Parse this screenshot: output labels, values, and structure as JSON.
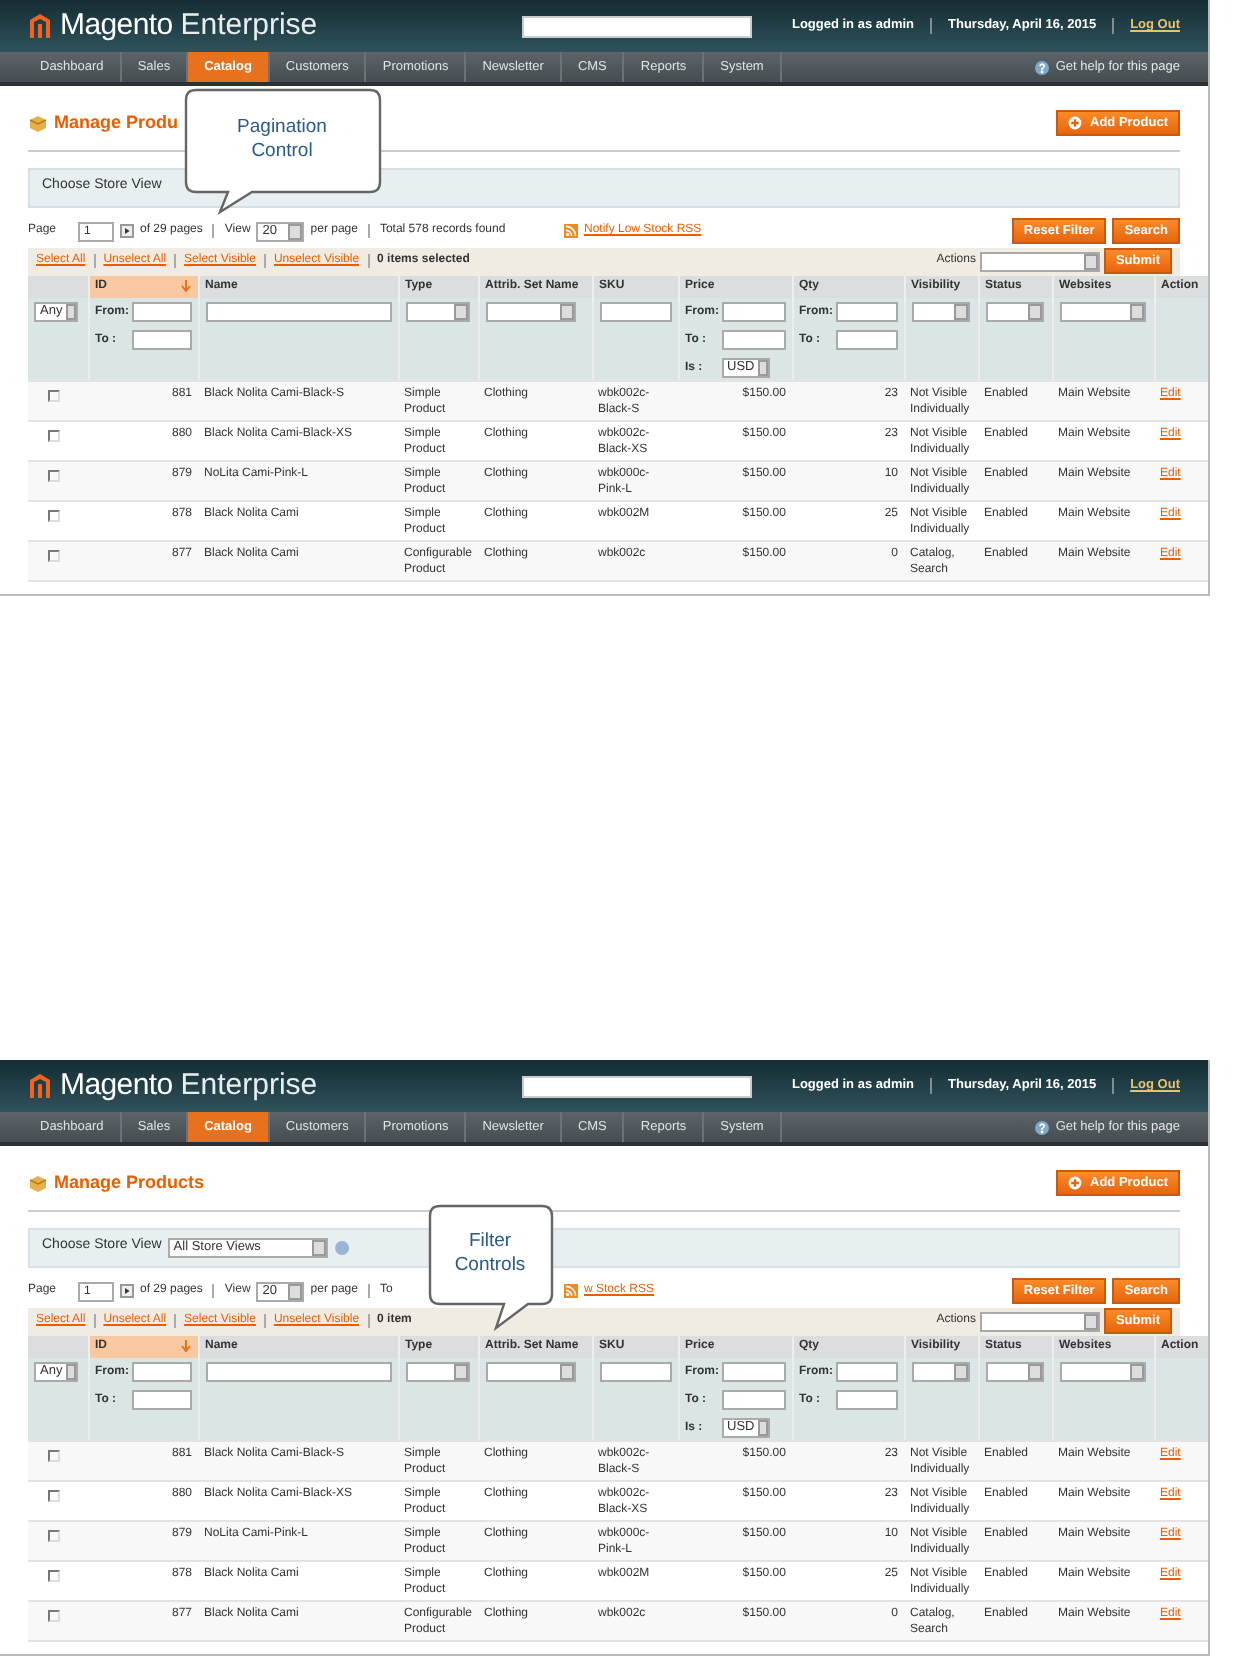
{
  "panels": [
    {
      "header": {
        "brand": "Magento",
        "edition": "Enterprise",
        "user": "Logged in as admin",
        "date": "Thursday, April 16, 2015",
        "logout": "Log Out"
      },
      "nav": [
        {
          "label": "Dashboard",
          "selected": false
        },
        {
          "label": "Sales",
          "selected": false
        },
        {
          "label": "Catalog",
          "selected": true
        },
        {
          "label": "Customers",
          "selected": false
        },
        {
          "label": "Promotions",
          "selected": false
        },
        {
          "label": "Newsletter",
          "selected": false
        },
        {
          "label": "CMS",
          "selected": false
        },
        {
          "label": "Reports",
          "selected": false
        },
        {
          "label": "System",
          "selected": false
        }
      ],
      "help": "Get help for this page",
      "page_title": "Manage Produ",
      "add_button": "Add Product",
      "store_view": {
        "label": "Choose Store View"
      },
      "pagination": {
        "page_label": "Page",
        "page_value": "1",
        "of_pages": "of 29 pages",
        "view_label": "View",
        "view_value": "20",
        "per_page": "per page",
        "total": "Total 578 records found",
        "rss_link": "Notify Low Stock RSS"
      },
      "reset_filter": "Reset Filter",
      "search_button": "Search",
      "mass_actions": [
        "Select All",
        "Unselect All",
        "Select Visible",
        "Unselect Visible"
      ],
      "selected_count": "0 items selected",
      "actions_label": "Actions",
      "submit": "Submit",
      "columns": [
        {},
        {
          "label": "ID",
          "sorted": true
        },
        {
          "label": "Name",
          "sorted": false
        },
        {
          "label": "Type",
          "sorted": false
        },
        {
          "label": "Attrib. Set Name",
          "sorted": false
        },
        {
          "label": "SKU",
          "sorted": false
        },
        {
          "label": "Price",
          "sorted": false
        },
        {
          "label": "Qty",
          "sorted": false
        },
        {
          "label": "Visibility",
          "sorted": false
        },
        {
          "label": "Status",
          "sorted": false
        },
        {
          "label": "Websites",
          "sorted": false
        },
        {
          "label": "Action",
          "sorted": false
        }
      ],
      "filters": [
        {
          "kind": "select",
          "value": "Any"
        },
        {
          "kind": "range",
          "from": "From:",
          "to": "To :"
        },
        {
          "kind": "text"
        },
        {
          "kind": "select"
        },
        {
          "kind": "select"
        },
        {
          "kind": "text"
        },
        {
          "kind": "range",
          "from": "From:",
          "to": "To :",
          "is": "Is :",
          "currency": "USD"
        },
        {
          "kind": "range",
          "from": "From:",
          "to": "To :"
        },
        {
          "kind": "select"
        },
        {
          "kind": "select"
        },
        {
          "kind": "select"
        }
      ],
      "rows": [
        {
          "checked": false,
          "id": "881",
          "name": "Black Nolita Cami-Black-S",
          "type": "Simple Product",
          "attrib": "Clothing",
          "sku": "wbk002c-Black-S",
          "price": "$150.00",
          "qty": "23",
          "visibility": "Not Visible Individually",
          "status": "Enabled",
          "website": "Main Website",
          "action": "Edit"
        },
        {
          "checked": false,
          "id": "880",
          "name": "Black Nolita Cami-Black-XS",
          "type": "Simple Product",
          "attrib": "Clothing",
          "sku": "wbk002c-Black-XS",
          "price": "$150.00",
          "qty": "23",
          "visibility": "Not Visible Individually",
          "status": "Enabled",
          "website": "Main Website",
          "action": "Edit"
        },
        {
          "checked": false,
          "id": "879",
          "name": "NoLita Cami-Pink-L",
          "type": "Simple Product",
          "attrib": "Clothing",
          "sku": "wbk000c-Pink-L",
          "price": "$150.00",
          "qty": "10",
          "visibility": "Not Visible Individually",
          "status": "Enabled",
          "website": "Main Website",
          "action": "Edit"
        },
        {
          "checked": false,
          "id": "878",
          "name": "Black Nolita Cami",
          "type": "Simple Product",
          "attrib": "Clothing",
          "sku": "wbk002M",
          "price": "$150.00",
          "qty": "25",
          "visibility": "Not Visible Individually",
          "status": "Enabled",
          "website": "Main Website",
          "action": "Edit"
        },
        {
          "checked": false,
          "id": "877",
          "name": "Black Nolita Cami",
          "type": "Configurable Product",
          "attrib": "Clothing",
          "sku": "wbk002c",
          "price": "$150.00",
          "qty": "0",
          "visibility": "Catalog, Search",
          "status": "Enabled",
          "website": "Main Website",
          "action": "Edit"
        }
      ],
      "callout": {
        "kind": "pagination",
        "lines": [
          "Pagination",
          "Control"
        ]
      }
    },
    {
      "header": {
        "brand": "Magento",
        "edition": "Enterprise",
        "user": "Logged in as admin",
        "date": "Thursday, April 16, 2015",
        "logout": "Log Out"
      },
      "nav": [
        {
          "label": "Dashboard",
          "selected": false
        },
        {
          "label": "Sales",
          "selected": false
        },
        {
          "label": "Catalog",
          "selected": true
        },
        {
          "label": "Customers",
          "selected": false
        },
        {
          "label": "Promotions",
          "selected": false
        },
        {
          "label": "Newsletter",
          "selected": false
        },
        {
          "label": "CMS",
          "selected": false
        },
        {
          "label": "Reports",
          "selected": false
        },
        {
          "label": "System",
          "selected": false
        }
      ],
      "help": "Get help for this page",
      "page_title": "Manage Products",
      "add_button": "Add Product",
      "store_view": {
        "label": "Choose Store View",
        "value": "All Store Views"
      },
      "pagination": {
        "page_label": "Page",
        "page_value": "1",
        "of_pages": "of 29 pages",
        "view_label": "View",
        "view_value": "20",
        "per_page": "per page",
        "total": "To",
        "rss_link": "w Stock RSS"
      },
      "reset_filter": "Reset Filter",
      "search_button": "Search",
      "mass_actions": [
        "Select All",
        "Unselect All",
        "Select Visible",
        "Unselect Visible"
      ],
      "selected_count": "0 item",
      "actions_label": "Actions",
      "submit": "Submit",
      "columns": [
        {},
        {
          "label": "ID",
          "sorted": true
        },
        {
          "label": "Name",
          "sorted": false
        },
        {
          "label": "Type",
          "sorted": false
        },
        {
          "label": "Attrib. Set Name",
          "sorted": false
        },
        {
          "label": "SKU",
          "sorted": false
        },
        {
          "label": "Price",
          "sorted": false
        },
        {
          "label": "Qty",
          "sorted": false
        },
        {
          "label": "Visibility",
          "sorted": false
        },
        {
          "label": "Status",
          "sorted": false
        },
        {
          "label": "Websites",
          "sorted": false
        },
        {
          "label": "Action",
          "sorted": false
        }
      ],
      "filters": [
        {
          "kind": "select",
          "value": "Any"
        },
        {
          "kind": "range",
          "from": "From:",
          "to": "To :"
        },
        {
          "kind": "text"
        },
        {
          "kind": "select"
        },
        {
          "kind": "select"
        },
        {
          "kind": "text"
        },
        {
          "kind": "range",
          "from": "From:",
          "to": "To :",
          "is": "Is :",
          "currency": "USD"
        },
        {
          "kind": "range",
          "from": "From:",
          "to": "To :"
        },
        {
          "kind": "select"
        },
        {
          "kind": "select"
        },
        {
          "kind": "select"
        }
      ],
      "rows": [
        {
          "checked": false,
          "id": "881",
          "name": "Black Nolita Cami-Black-S",
          "type": "Simple Product",
          "attrib": "Clothing",
          "sku": "wbk002c-Black-S",
          "price": "$150.00",
          "qty": "23",
          "visibility": "Not Visible Individually",
          "status": "Enabled",
          "website": "Main Website",
          "action": "Edit"
        },
        {
          "checked": false,
          "id": "880",
          "name": "Black Nolita Cami-Black-XS",
          "type": "Simple Product",
          "attrib": "Clothing",
          "sku": "wbk002c-Black-XS",
          "price": "$150.00",
          "qty": "23",
          "visibility": "Not Visible Individually",
          "status": "Enabled",
          "website": "Main Website",
          "action": "Edit"
        },
        {
          "checked": false,
          "id": "879",
          "name": "NoLita Cami-Pink-L",
          "type": "Simple Product",
          "attrib": "Clothing",
          "sku": "wbk000c-Pink-L",
          "price": "$150.00",
          "qty": "10",
          "visibility": "Not Visible Individually",
          "status": "Enabled",
          "website": "Main Website",
          "action": "Edit"
        },
        {
          "checked": false,
          "id": "878",
          "name": "Black Nolita Cami",
          "type": "Simple Product",
          "attrib": "Clothing",
          "sku": "wbk002M",
          "price": "$150.00",
          "qty": "25",
          "visibility": "Not Visible Individually",
          "status": "Enabled",
          "website": "Main Website",
          "action": "Edit"
        },
        {
          "checked": false,
          "id": "877",
          "name": "Black Nolita Cami",
          "type": "Configurable Product",
          "attrib": "Clothing",
          "sku": "wbk002c",
          "price": "$150.00",
          "qty": "0",
          "visibility": "Catalog, Search",
          "status": "Enabled",
          "website": "Main Website",
          "action": "Edit"
        }
      ],
      "callout": {
        "kind": "filter",
        "lines": [
          "Filter",
          "Controls"
        ]
      }
    }
  ]
}
